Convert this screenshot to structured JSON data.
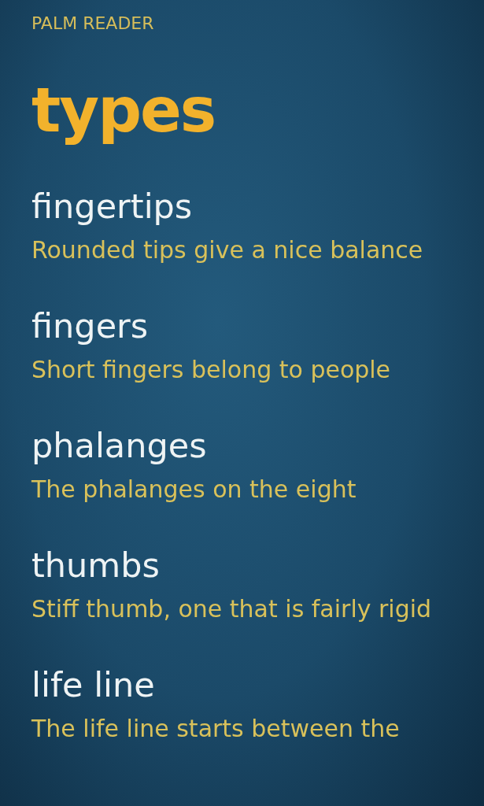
{
  "app_title": "PALM READER",
  "heading": "types",
  "items": [
    {
      "title": "fingertips",
      "description": "Rounded tips give a nice balance"
    },
    {
      "title": "fingers",
      "description": "Short fingers belong to people"
    },
    {
      "title": "phalanges",
      "description": "The phalanges on the eight"
    },
    {
      "title": "thumbs",
      "description": "Stiff thumb, one that is fairly rigid"
    },
    {
      "title": "life line",
      "description": "The life line starts between the"
    }
  ]
}
